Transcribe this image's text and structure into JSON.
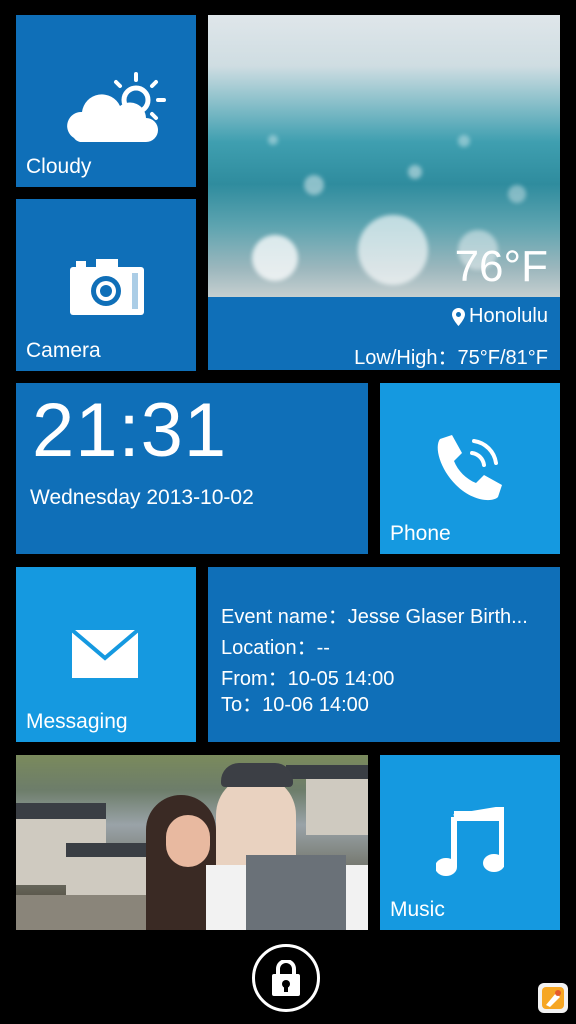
{
  "tiles": {
    "weather_small": {
      "label": "Cloudy",
      "icon": "cloud-sun-icon"
    },
    "camera": {
      "label": "Camera",
      "icon": "camera-icon"
    },
    "weather_large": {
      "temperature": "76°F",
      "location": "Honolulu",
      "location_icon": "map-pin-icon",
      "low_high": "Low/High：75°F/81°F"
    },
    "clock": {
      "time": "21:31",
      "date": "Wednesday 2013-10-02"
    },
    "phone": {
      "label": "Phone",
      "icon": "phone-icon"
    },
    "messaging": {
      "label": "Messaging",
      "icon": "envelope-icon"
    },
    "event": {
      "name": "Event name：Jesse Glaser Birth...",
      "location": "Location：--",
      "from": "From：10-05 14:00",
      "to": "To：10-06 14:00"
    },
    "photo": {
      "icon": "photo-icon"
    },
    "music": {
      "label": "Music",
      "icon": "music-note-icon"
    }
  },
  "lock": {
    "icon": "lock-icon"
  },
  "colors": {
    "tile_dark": "#0f6fb8",
    "tile_light": "#1599e0",
    "background": "#000000"
  }
}
